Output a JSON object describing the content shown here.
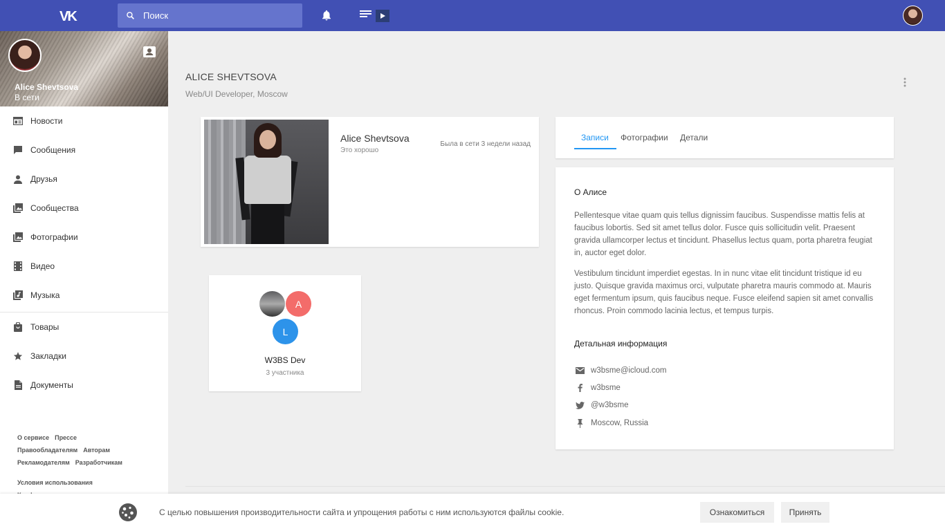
{
  "topbar": {
    "logo": "VK",
    "search_placeholder": "Поиск"
  },
  "sidebar": {
    "user_name": "Alice Shevtsova",
    "user_status": "В сети",
    "items": [
      {
        "label": "Новости",
        "icon": "news-icon"
      },
      {
        "label": "Сообщения",
        "icon": "message-icon"
      },
      {
        "label": "Друзья",
        "icon": "person-icon"
      },
      {
        "label": "Сообщества",
        "icon": "communities-icon"
      },
      {
        "label": "Фотографии",
        "icon": "photos-icon"
      },
      {
        "label": "Видео",
        "icon": "video-icon"
      },
      {
        "label": "Музыка",
        "icon": "music-icon"
      },
      {
        "label": "Товары",
        "icon": "bag-icon"
      },
      {
        "label": "Закладки",
        "icon": "star-icon"
      },
      {
        "label": "Документы",
        "icon": "document-icon"
      }
    ],
    "footer": {
      "about": "О сервисе",
      "press": "Прессе",
      "rights": "Правообладателям",
      "authors": "Авторам",
      "advertisers": "Рекламодателям",
      "developers": "Разработчикам",
      "terms": "Условия использования",
      "privacy": "Конфиденциальность"
    }
  },
  "header": {
    "title": "ALICE SHEVTSOVA",
    "subtitle": "Web/UI Developer, Moscow"
  },
  "profile_card": {
    "name": "Alice Shevtsova",
    "status": "Это хорошо",
    "last_seen": "Была в сети 3 недели назад"
  },
  "group": {
    "avatar_a": "A",
    "avatar_l": "L",
    "name": "W3BS Dev",
    "members": "3 участника"
  },
  "tabs": {
    "posts": "Записи",
    "photos": "Фотографии",
    "details": "Детали"
  },
  "about": {
    "title": "О Алисе",
    "p1": "Pellentesque vitae quam quis tellus dignissim faucibus. Suspendisse mattis felis at faucibus lobortis. Sed sit amet tellus dolor. Fusce quis sollicitudin velit. Praesent gravida ullamcorper lectus et tincidunt. Phasellus lectus quam, porta pharetra feugiat in, auctor eget dolor.",
    "p2": "Vestibulum tincidunt imperdiet egestas. In in nunc vitae elit tincidunt tristique id eu justo. Quisque gravida maximus orci, vulputate pharetra mauris commodo at. Mauris eget fermentum ipsum, quis faucibus neque. Fusce eleifend sapien sit amet convallis rhoncus. Proin commodo lacinia lectus, et tempus turpis.",
    "details_title": "Детальная информация",
    "email": "w3bsme@icloud.com",
    "facebook": "w3bsme",
    "twitter": "@w3bsme",
    "location": "Moscow, Russia"
  },
  "cookie": {
    "text": "С целью повышения производительности сайта и упрощения работы с ним используются файлы cookie.",
    "learn": "Ознакомиться",
    "accept": "Принять"
  },
  "colors": {
    "brand": "#4150b4",
    "accent": "#2196f3",
    "avatar_a": "#f36c6a",
    "avatar_l": "#2d93ea"
  }
}
